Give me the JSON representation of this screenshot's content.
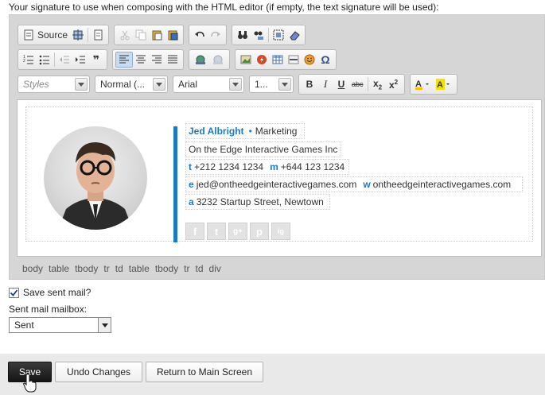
{
  "intro_text": "Your signature to use when composing with the HTML editor (if empty, the text signature will be used):",
  "toolbar": {
    "source_label": "Source",
    "styles_placeholder": "Styles",
    "format_value": "Normal (...",
    "font_value": "Arial",
    "size_value": "1...",
    "bold_label": "B",
    "italic_label": "I",
    "underline_label": "U",
    "strike_label": "abc",
    "subscript_label": "x",
    "subscript_sub": "2",
    "superscript_label": "x",
    "superscript_sup": "2",
    "omega_label": "Ω",
    "quote_label": "❞"
  },
  "signature": {
    "name": "Jed Albright",
    "dot": "•",
    "department": "Marketing",
    "company": "On the Edge Interactive Games Inc",
    "t_label": "t",
    "phone": "+212 1234 1234",
    "m_label": "m",
    "mobile": "+644 123 1234",
    "e_label": "e",
    "email": "jed@ontheedgeinteractivegames.com",
    "w_label": "w",
    "website": "ontheedgeinteractivegames.com",
    "a_label": "a",
    "address": "3232 Startup Street, Newtown",
    "social": [
      "f",
      "t",
      "g+",
      "p",
      "ig"
    ]
  },
  "element_path": [
    "body",
    "table",
    "tbody",
    "tr",
    "td",
    "table",
    "tbody",
    "tr",
    "td",
    "div"
  ],
  "save_sent": {
    "label": "Save sent mail?",
    "checked": true
  },
  "mailbox": {
    "label": "Sent mail mailbox:",
    "value": "Sent"
  },
  "buttons": {
    "save": "Save",
    "undo": "Undo Changes",
    "return": "Return to Main Screen"
  },
  "colors": {
    "accent_blue": "#1a7ac4",
    "footer_bg": "#e9e9e9",
    "toolbar_bg": "#d6d6d6"
  }
}
